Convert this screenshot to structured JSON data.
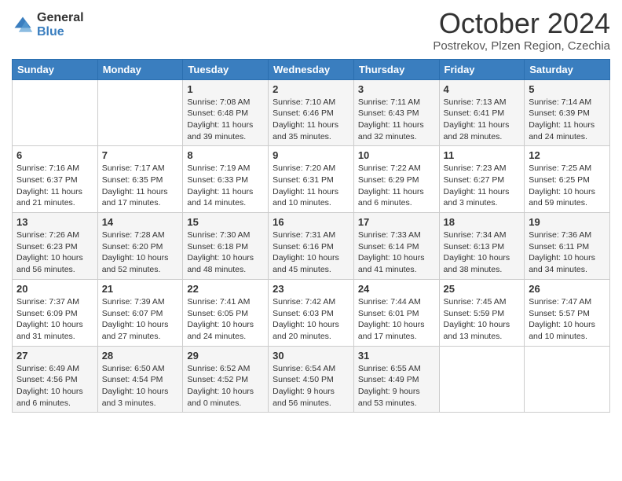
{
  "logo": {
    "general": "General",
    "blue": "Blue"
  },
  "header": {
    "month": "October 2024",
    "location": "Postrekov, Plzen Region, Czechia"
  },
  "weekdays": [
    "Sunday",
    "Monday",
    "Tuesday",
    "Wednesday",
    "Thursday",
    "Friday",
    "Saturday"
  ],
  "weeks": [
    [
      {
        "day": "",
        "info": ""
      },
      {
        "day": "",
        "info": ""
      },
      {
        "day": "1",
        "info": "Sunrise: 7:08 AM\nSunset: 6:48 PM\nDaylight: 11 hours and 39 minutes."
      },
      {
        "day": "2",
        "info": "Sunrise: 7:10 AM\nSunset: 6:46 PM\nDaylight: 11 hours and 35 minutes."
      },
      {
        "day": "3",
        "info": "Sunrise: 7:11 AM\nSunset: 6:43 PM\nDaylight: 11 hours and 32 minutes."
      },
      {
        "day": "4",
        "info": "Sunrise: 7:13 AM\nSunset: 6:41 PM\nDaylight: 11 hours and 28 minutes."
      },
      {
        "day": "5",
        "info": "Sunrise: 7:14 AM\nSunset: 6:39 PM\nDaylight: 11 hours and 24 minutes."
      }
    ],
    [
      {
        "day": "6",
        "info": "Sunrise: 7:16 AM\nSunset: 6:37 PM\nDaylight: 11 hours and 21 minutes."
      },
      {
        "day": "7",
        "info": "Sunrise: 7:17 AM\nSunset: 6:35 PM\nDaylight: 11 hours and 17 minutes."
      },
      {
        "day": "8",
        "info": "Sunrise: 7:19 AM\nSunset: 6:33 PM\nDaylight: 11 hours and 14 minutes."
      },
      {
        "day": "9",
        "info": "Sunrise: 7:20 AM\nSunset: 6:31 PM\nDaylight: 11 hours and 10 minutes."
      },
      {
        "day": "10",
        "info": "Sunrise: 7:22 AM\nSunset: 6:29 PM\nDaylight: 11 hours and 6 minutes."
      },
      {
        "day": "11",
        "info": "Sunrise: 7:23 AM\nSunset: 6:27 PM\nDaylight: 11 hours and 3 minutes."
      },
      {
        "day": "12",
        "info": "Sunrise: 7:25 AM\nSunset: 6:25 PM\nDaylight: 10 hours and 59 minutes."
      }
    ],
    [
      {
        "day": "13",
        "info": "Sunrise: 7:26 AM\nSunset: 6:23 PM\nDaylight: 10 hours and 56 minutes."
      },
      {
        "day": "14",
        "info": "Sunrise: 7:28 AM\nSunset: 6:20 PM\nDaylight: 10 hours and 52 minutes."
      },
      {
        "day": "15",
        "info": "Sunrise: 7:30 AM\nSunset: 6:18 PM\nDaylight: 10 hours and 48 minutes."
      },
      {
        "day": "16",
        "info": "Sunrise: 7:31 AM\nSunset: 6:16 PM\nDaylight: 10 hours and 45 minutes."
      },
      {
        "day": "17",
        "info": "Sunrise: 7:33 AM\nSunset: 6:14 PM\nDaylight: 10 hours and 41 minutes."
      },
      {
        "day": "18",
        "info": "Sunrise: 7:34 AM\nSunset: 6:13 PM\nDaylight: 10 hours and 38 minutes."
      },
      {
        "day": "19",
        "info": "Sunrise: 7:36 AM\nSunset: 6:11 PM\nDaylight: 10 hours and 34 minutes."
      }
    ],
    [
      {
        "day": "20",
        "info": "Sunrise: 7:37 AM\nSunset: 6:09 PM\nDaylight: 10 hours and 31 minutes."
      },
      {
        "day": "21",
        "info": "Sunrise: 7:39 AM\nSunset: 6:07 PM\nDaylight: 10 hours and 27 minutes."
      },
      {
        "day": "22",
        "info": "Sunrise: 7:41 AM\nSunset: 6:05 PM\nDaylight: 10 hours and 24 minutes."
      },
      {
        "day": "23",
        "info": "Sunrise: 7:42 AM\nSunset: 6:03 PM\nDaylight: 10 hours and 20 minutes."
      },
      {
        "day": "24",
        "info": "Sunrise: 7:44 AM\nSunset: 6:01 PM\nDaylight: 10 hours and 17 minutes."
      },
      {
        "day": "25",
        "info": "Sunrise: 7:45 AM\nSunset: 5:59 PM\nDaylight: 10 hours and 13 minutes."
      },
      {
        "day": "26",
        "info": "Sunrise: 7:47 AM\nSunset: 5:57 PM\nDaylight: 10 hours and 10 minutes."
      }
    ],
    [
      {
        "day": "27",
        "info": "Sunrise: 6:49 AM\nSunset: 4:56 PM\nDaylight: 10 hours and 6 minutes."
      },
      {
        "day": "28",
        "info": "Sunrise: 6:50 AM\nSunset: 4:54 PM\nDaylight: 10 hours and 3 minutes."
      },
      {
        "day": "29",
        "info": "Sunrise: 6:52 AM\nSunset: 4:52 PM\nDaylight: 10 hours and 0 minutes."
      },
      {
        "day": "30",
        "info": "Sunrise: 6:54 AM\nSunset: 4:50 PM\nDaylight: 9 hours and 56 minutes."
      },
      {
        "day": "31",
        "info": "Sunrise: 6:55 AM\nSunset: 4:49 PM\nDaylight: 9 hours and 53 minutes."
      },
      {
        "day": "",
        "info": ""
      },
      {
        "day": "",
        "info": ""
      }
    ]
  ]
}
